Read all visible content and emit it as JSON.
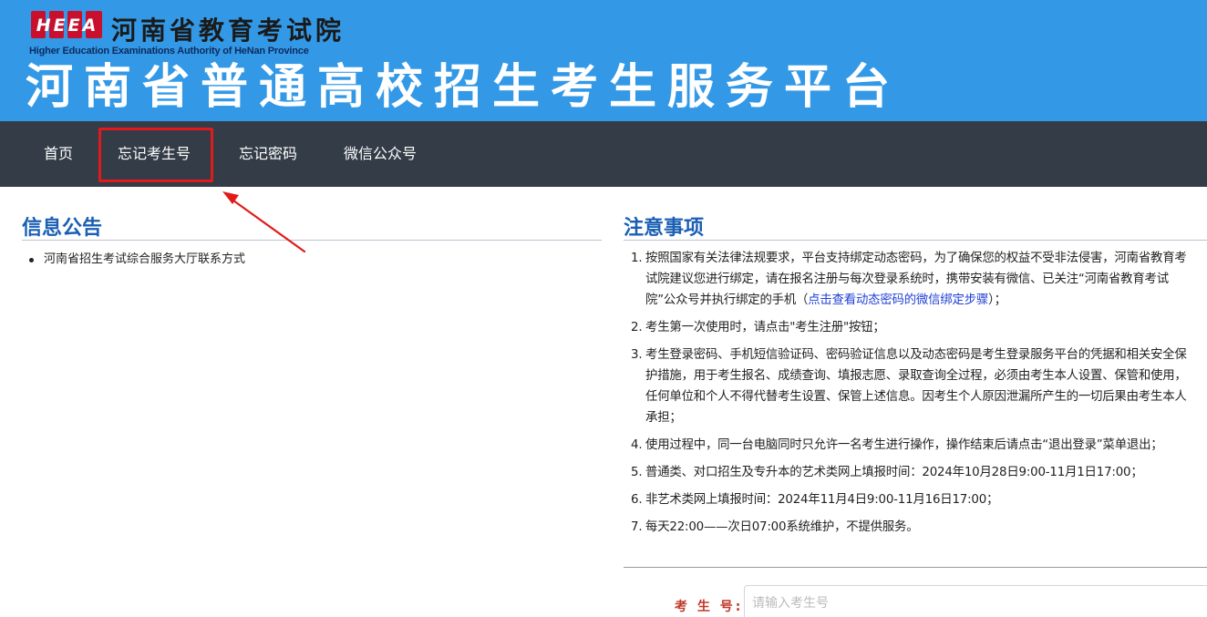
{
  "header": {
    "logo_text": "HEEA",
    "org_name": "河南省教育考试院",
    "org_name_en": "Higher Education Examinations Authority of HeNan Province",
    "platform_title": "河南省普通高校招生考生服务平台"
  },
  "nav": {
    "items": [
      {
        "label": "首页"
      },
      {
        "label": "忘记考生号"
      },
      {
        "label": "忘记密码"
      },
      {
        "label": "微信公众号"
      }
    ],
    "highlighted_index": 1
  },
  "announcements": {
    "title": "信息公告",
    "items": [
      {
        "text": "河南省招生考试综合服务大厅联系方式"
      }
    ]
  },
  "notices": {
    "title": "注意事项",
    "items": [
      {
        "num": "1.",
        "text_before": "按照国家有关法律法规要求，平台支持绑定动态密码，为了确保您的权益不受非法侵害，河南省教育考试院建议您进行绑定，请在报名注册与每次登录系统时，携带安装有微信、已关注“河南省教育考试院”公众号并执行绑定的手机（",
        "link": "点击查看动态密码的微信绑定步骤",
        "text_after": "）；"
      },
      {
        "num": "2.",
        "text": "考生第一次使用时，请点击\"考生注册\"按钮；"
      },
      {
        "num": "3.",
        "text": "考生登录密码、手机短信验证码、密码验证信息以及动态密码是考生登录服务平台的凭据和相关安全保护措施，用于考生报名、成绩查询、填报志愿、录取查询全过程，必须由考生本人设置、保管和使用，任何单位和个人不得代替考生设置、保管上述信息。因考生个人原因泄漏所产生的一切后果由考生本人承担；"
      },
      {
        "num": "4.",
        "text": "使用过程中，同一台电脑同时只允许一名考生进行操作，操作结束后请点击“退出登录”菜单退出；"
      },
      {
        "num": "5.",
        "text": "普通类、对口招生及专升本的艺术类网上填报时间：2024年10月28日9:00-11月1日17:00；"
      },
      {
        "num": "6.",
        "text": "非艺术类网上填报时间：2024年11月4日9:00-11月16日17:00；"
      },
      {
        "num": "7.",
        "text": "每天22:00——次日07:00系统维护，不提供服务。"
      }
    ]
  },
  "login": {
    "exam_no_label": "考 生 号:",
    "exam_no_placeholder": "请输入考生号",
    "exam_no_value": ""
  },
  "colors": {
    "header_bg": "#3399e6",
    "nav_bg": "#333c47",
    "highlight": "#e11b1b",
    "section_title": "#1a5fb4",
    "link": "#1f3fd6"
  },
  "icons": {
    "logo": "heea-logo-icon",
    "annotation": "red-arrow-icon"
  }
}
